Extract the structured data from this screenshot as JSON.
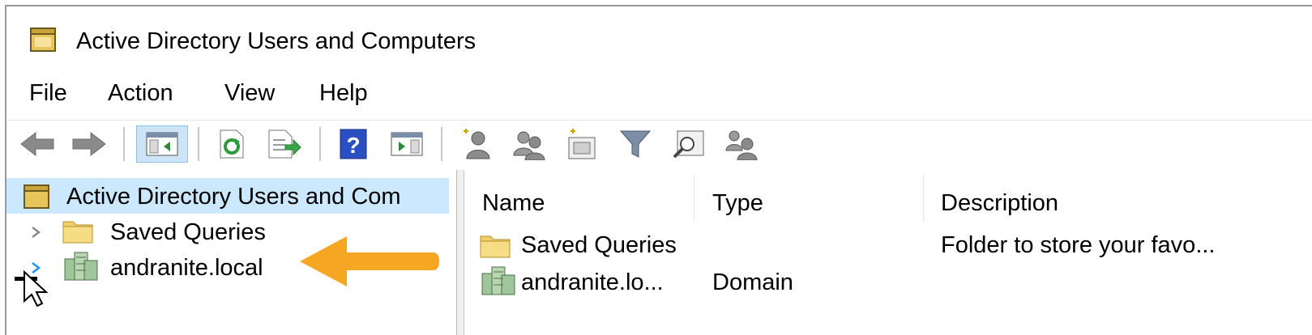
{
  "window": {
    "title": "Active Directory Users and Computers"
  },
  "menu": {
    "items": [
      "File",
      "Action",
      "View",
      "Help"
    ]
  },
  "toolbar": {
    "buttons": [
      "back-icon",
      "forward-icon",
      "show-hide-console-tree-icon",
      "refresh-icon",
      "export-list-icon",
      "help-icon",
      "show-action-pane-icon",
      "new-user-icon",
      "new-group-icon",
      "new-ou-icon",
      "filter-icon",
      "find-icon",
      "add-to-group-icon"
    ]
  },
  "tree": {
    "root_label": "Active Directory Users and Com",
    "items": [
      {
        "label": "Saved Queries",
        "icon": "folder-icon"
      },
      {
        "label": "andranite.local",
        "icon": "domain-icon"
      }
    ]
  },
  "list": {
    "columns": [
      "Name",
      "Type",
      "Description"
    ],
    "rows": [
      {
        "name": "Saved Queries",
        "type": "",
        "description": "Folder to store your favo...",
        "icon": "folder-icon"
      },
      {
        "name": "andranite.lo...",
        "type": "Domain",
        "description": "",
        "icon": "domain-icon"
      }
    ]
  },
  "colors": {
    "selection": "#cce8ff",
    "annotation_arrow": "#f5a623",
    "folder": "#f2cf6b"
  }
}
